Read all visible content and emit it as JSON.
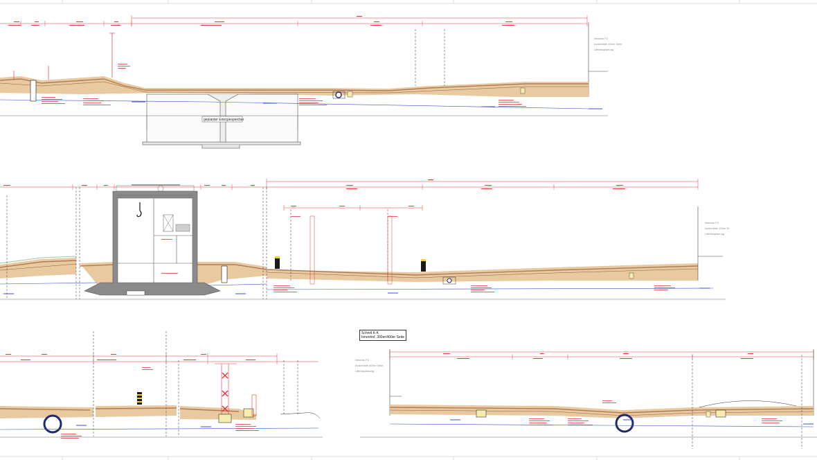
{
  "colors": {
    "dim_red": "#e8333a",
    "soil_fill": "#e8c9a0",
    "layer_brown": "#b07c58",
    "water_blue": "#3b4fd1",
    "structure_gray": "#7a7a7a",
    "pipe_navy": "#1f2a6b",
    "marker_yellow": "#f2d21a",
    "marker_black": "#1a1a1a",
    "ground_green": "#9ec59a"
  },
  "section_top": {
    "storage_label": "geplanter Energiespeicher",
    "notes": [
      "Neubau FZ",
      "Außenliste 100er Seite",
      "Ufertlasplanung"
    ]
  },
  "section_middle": {
    "notes": [
      "Neubau FZ",
      "Außenliste 100er Si",
      "Ufertlasplanung"
    ]
  },
  "section_kk": {
    "title_line1": "Schnitt K-K",
    "title_line2": "Innenhof, 300er/400er Seite",
    "notes": [
      "Neubau FZ",
      "Außenliste 300er Seite",
      "Uferlasplanung"
    ]
  },
  "icons": [
    "crane-hook-icon",
    "cross-marker-icon",
    "pipe-section-icon",
    "pile-marker-icon"
  ]
}
